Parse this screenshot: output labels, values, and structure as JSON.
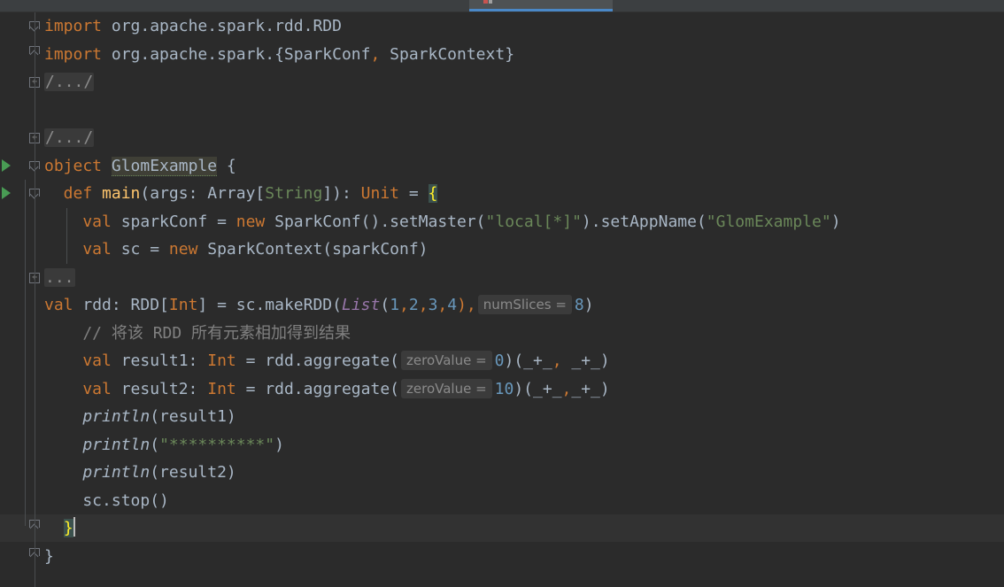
{
  "editor": {
    "lines": [
      {
        "segments": [
          {
            "t": "import",
            "c": "kw"
          },
          {
            "t": " org.apache.spark.rdd.RDD",
            "c": "dim"
          }
        ]
      },
      {
        "segments": [
          {
            "t": "import",
            "c": "kw"
          },
          {
            "t": " org.apache.spark.{SparkConf",
            "c": "dim"
          },
          {
            "t": ",",
            "c": "kw"
          },
          {
            "t": " SparkContext}",
            "c": "dim"
          }
        ]
      },
      {
        "segments": [
          {
            "t": "/.../",
            "c": "folded"
          }
        ]
      },
      {
        "segments": []
      },
      {
        "segments": [
          {
            "t": "/.../",
            "c": "folded"
          }
        ]
      },
      {
        "segments": [
          {
            "t": "object",
            "c": "kw"
          },
          {
            "t": " ",
            "c": "dim"
          },
          {
            "t": "GlomExample",
            "c": "obj-hl"
          },
          {
            "t": " {",
            "c": "dim"
          }
        ]
      },
      {
        "segments": [
          {
            "t": "  def ",
            "c": "kw"
          },
          {
            "t": "main",
            "c": "fn"
          },
          {
            "t": "(args: Array[",
            "c": "dim"
          },
          {
            "t": "String",
            "c": "str"
          },
          {
            "t": "]): ",
            "c": "dim"
          },
          {
            "t": "Unit",
            "c": "kw"
          },
          {
            "t": " = ",
            "c": "dim"
          },
          {
            "t": "{",
            "c": "brace-hl"
          }
        ]
      },
      {
        "segments": [
          {
            "t": "    val ",
            "c": "kw"
          },
          {
            "t": "sparkConf = ",
            "c": "dim"
          },
          {
            "t": "new ",
            "c": "kw"
          },
          {
            "t": "SparkConf().setMaster(",
            "c": "dim"
          },
          {
            "t": "\"local[*]\"",
            "c": "str"
          },
          {
            "t": ").setAppName(",
            "c": "dim"
          },
          {
            "t": "\"GlomExample\"",
            "c": "str"
          },
          {
            "t": ")",
            "c": "dim"
          }
        ]
      },
      {
        "segments": [
          {
            "t": "    val ",
            "c": "kw"
          },
          {
            "t": "sc = ",
            "c": "dim"
          },
          {
            "t": "new ",
            "c": "kw"
          },
          {
            "t": "SparkContext(sparkConf)",
            "c": "dim"
          }
        ]
      },
      {
        "segments": [
          {
            "t": "...",
            "c": "folded"
          }
        ]
      },
      {
        "segments": [
          {
            "t": "val ",
            "c": "kw"
          },
          {
            "t": "rdd: RDD[",
            "c": "dim"
          },
          {
            "t": "Int",
            "c": "kw"
          },
          {
            "t": "] = sc.makeRDD(",
            "c": "dim"
          },
          {
            "t": "List",
            "c": "list-it"
          },
          {
            "t": "(",
            "c": "dim"
          },
          {
            "t": "1",
            "c": "num"
          },
          {
            "t": ",",
            "c": "kw"
          },
          {
            "t": "2",
            "c": "num"
          },
          {
            "t": ",",
            "c": "kw"
          },
          {
            "t": "3",
            "c": "num"
          },
          {
            "t": ",",
            "c": "kw"
          },
          {
            "t": "4",
            "c": "num"
          },
          {
            "t": "),",
            "c": "kw"
          },
          {
            "t": "numSlices =",
            "c": "hint"
          },
          {
            "t": "8",
            "c": "num"
          },
          {
            "t": ")",
            "c": "dim"
          }
        ]
      },
      {
        "segments": [
          {
            "t": "    // 将该 RDD 所有元素相加得到结果",
            "c": "comment"
          }
        ]
      },
      {
        "segments": [
          {
            "t": "    val ",
            "c": "kw"
          },
          {
            "t": "result1: ",
            "c": "dim"
          },
          {
            "t": "Int",
            "c": "kw"
          },
          {
            "t": " = rdd.aggregate(",
            "c": "dim"
          },
          {
            "t": "zeroValue =",
            "c": "hint"
          },
          {
            "t": "0",
            "c": "num"
          },
          {
            "t": ")(_+_",
            "c": "dim"
          },
          {
            "t": ",",
            "c": "kw"
          },
          {
            "t": " _+_)",
            "c": "dim"
          }
        ]
      },
      {
        "segments": [
          {
            "t": "    val ",
            "c": "kw"
          },
          {
            "t": "result2: ",
            "c": "dim"
          },
          {
            "t": "Int",
            "c": "kw"
          },
          {
            "t": " = rdd.aggregate(",
            "c": "dim"
          },
          {
            "t": "zeroValue =",
            "c": "hint"
          },
          {
            "t": "10",
            "c": "num"
          },
          {
            "t": ")(_+_",
            "c": "dim"
          },
          {
            "t": ",",
            "c": "kw"
          },
          {
            "t": "_+_)",
            "c": "dim"
          }
        ]
      },
      {
        "segments": [
          {
            "t": "    ",
            "c": "dim"
          },
          {
            "t": "println",
            "c": "it"
          },
          {
            "t": "(result1)",
            "c": "dim"
          }
        ]
      },
      {
        "segments": [
          {
            "t": "    ",
            "c": "dim"
          },
          {
            "t": "println",
            "c": "it"
          },
          {
            "t": "(",
            "c": "dim"
          },
          {
            "t": "\"**********\"",
            "c": "str"
          },
          {
            "t": ")",
            "c": "dim"
          }
        ]
      },
      {
        "segments": [
          {
            "t": "    ",
            "c": "dim"
          },
          {
            "t": "println",
            "c": "it"
          },
          {
            "t": "(result2)",
            "c": "dim"
          }
        ]
      },
      {
        "segments": [
          {
            "t": "    sc.stop()",
            "c": "dim"
          }
        ]
      },
      {
        "segments": [
          {
            "t": "  ",
            "c": "dim"
          },
          {
            "t": "}",
            "c": "brace-hl"
          }
        ]
      },
      {
        "segments": [
          {
            "t": "}",
            "c": "dim"
          }
        ]
      }
    ],
    "current_line": 18
  },
  "gutter": {
    "run_lines": [
      5,
      6
    ],
    "fold_collapsed_lines": [
      2,
      4,
      9
    ],
    "fold_open_lines": [
      0,
      5,
      6
    ],
    "fold_close_lines": [
      1,
      18,
      19
    ]
  }
}
